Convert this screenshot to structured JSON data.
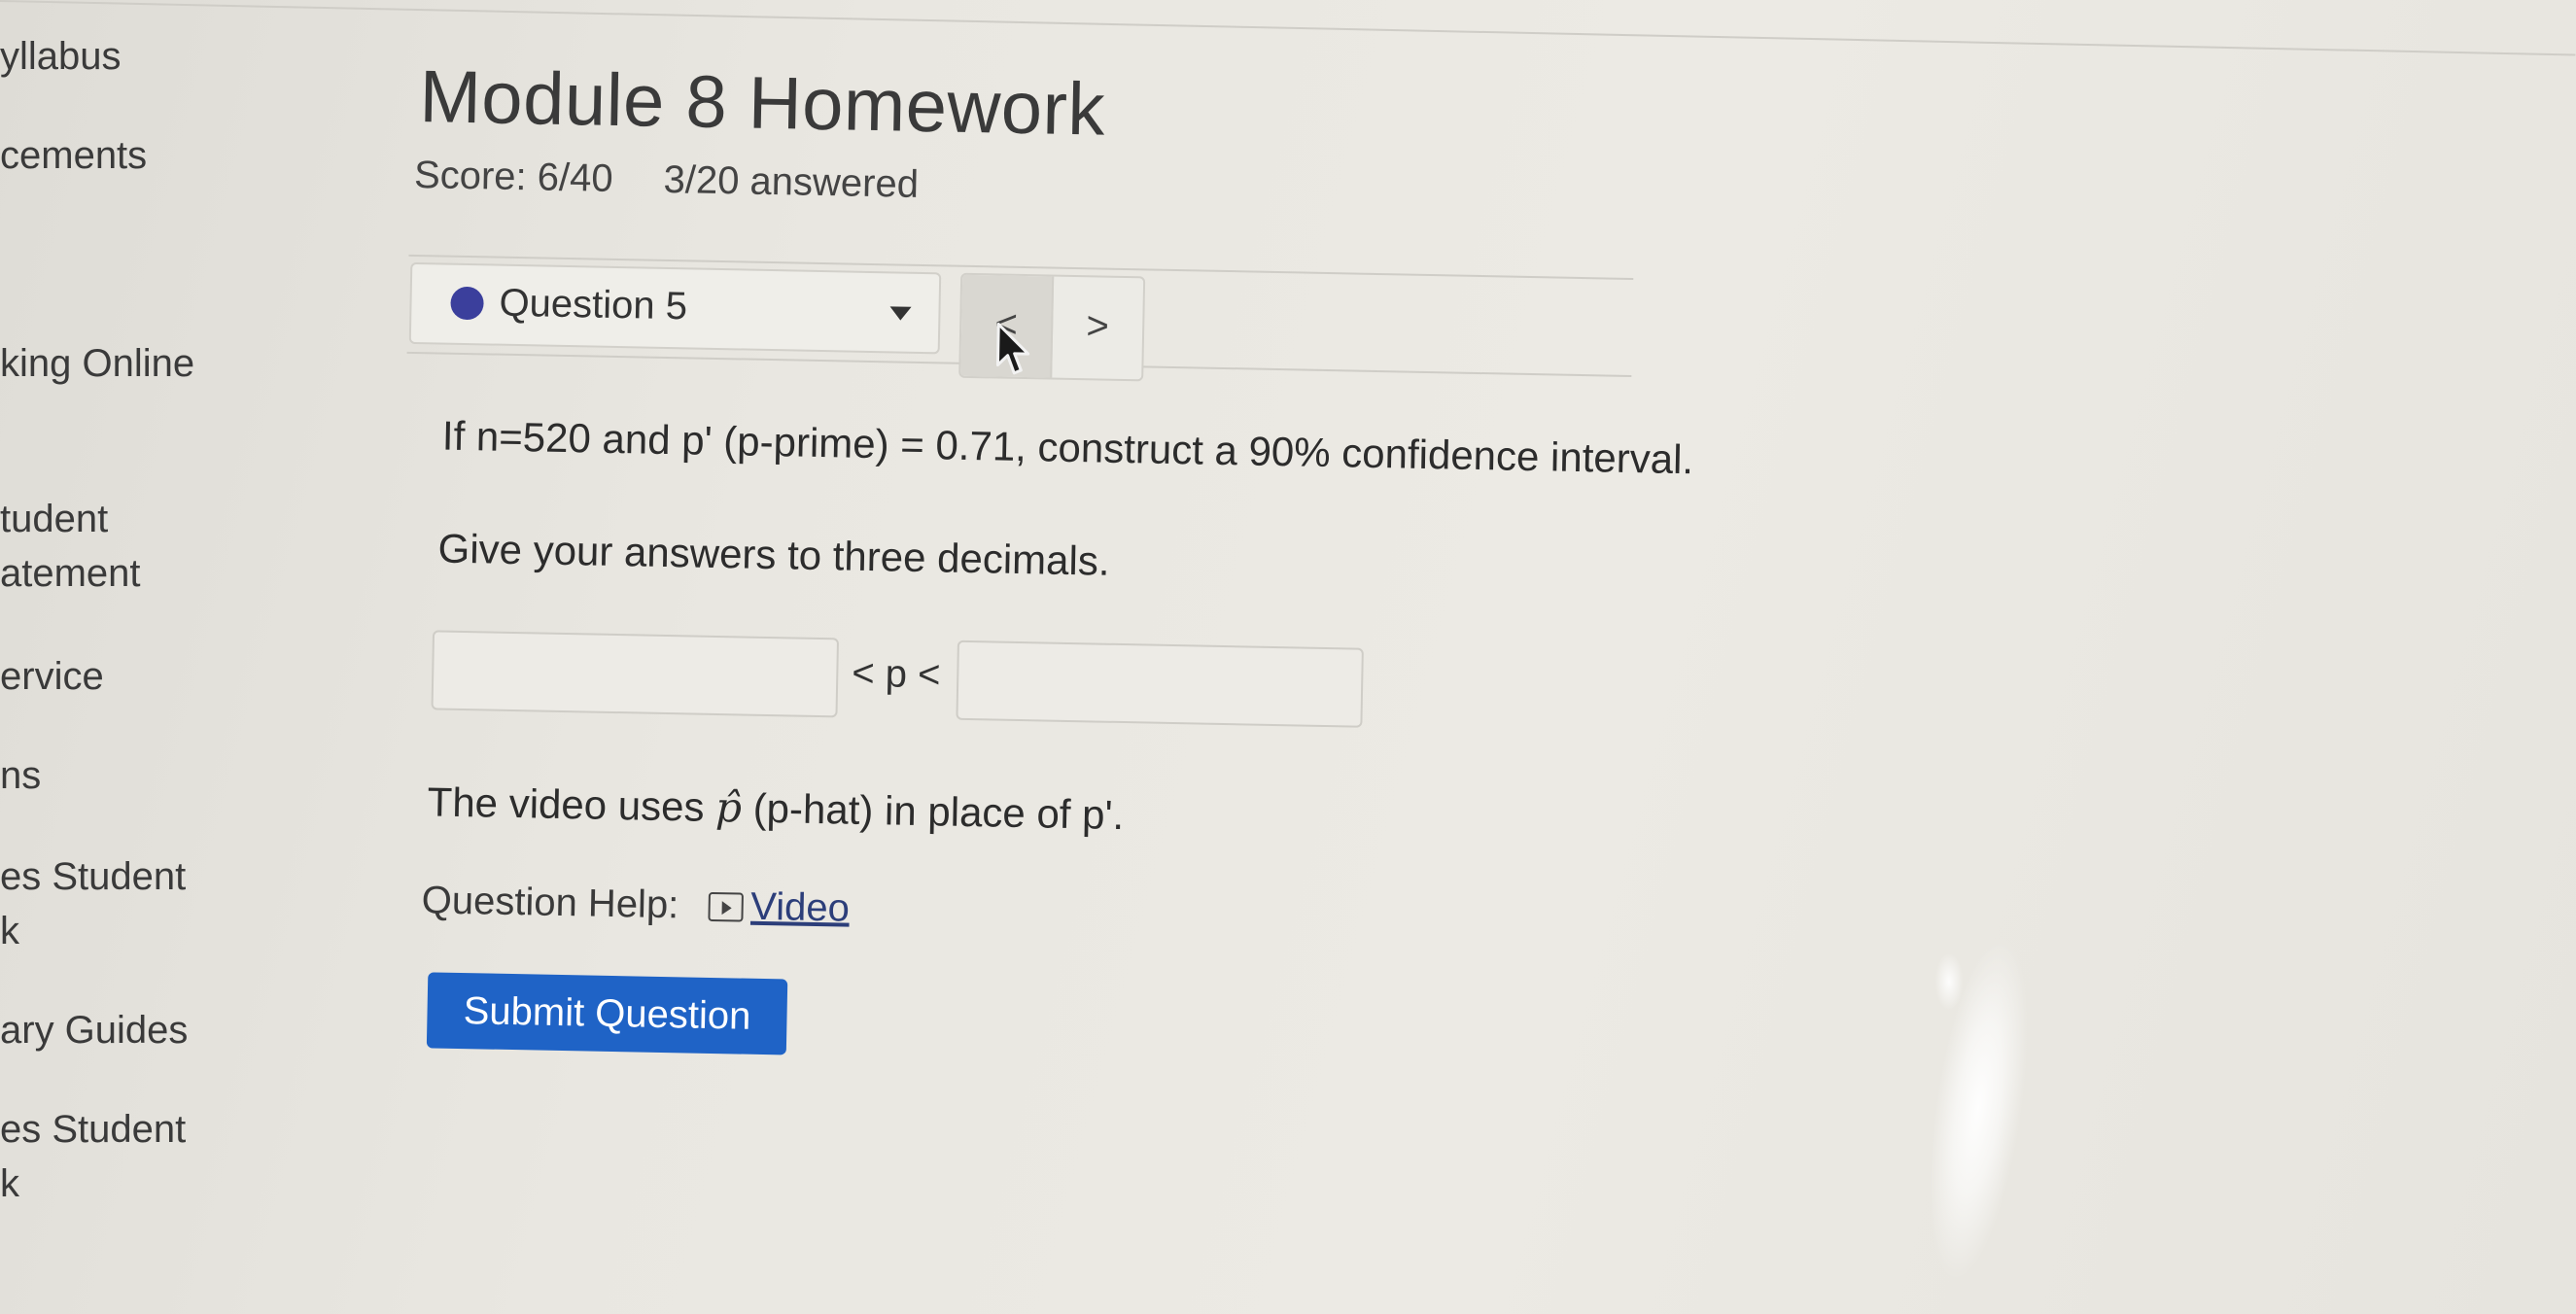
{
  "sidebar": {
    "items": [
      {
        "label": "yllabus"
      },
      {
        "label": "cements"
      },
      {
        "label": "king Online"
      },
      {
        "label": "tudent\natement"
      },
      {
        "label": "ervice"
      },
      {
        "label": "ns"
      },
      {
        "label": "es Student\nk"
      },
      {
        "label": "ary Guides"
      },
      {
        "label": "es Student\nk"
      }
    ]
  },
  "header": {
    "title": "Module 8 Homework",
    "score": "Score: 6/40",
    "answered": "3/20 answered"
  },
  "question_nav": {
    "selected": "Question 5",
    "status_color": "#3b3f9c",
    "prev_symbol": "<",
    "next_symbol": ">"
  },
  "question": {
    "prompt": "If n=520 and p' (p-prime) = 0.71, construct a 90% confidence interval.",
    "instruction": "Give your answers to three decimals.",
    "lower_value": "",
    "upper_value": "",
    "inequality": "< p <",
    "note_before": "The video uses ",
    "note_symbol": "p̂",
    "note_after": " (p-hat) in place of p'."
  },
  "help": {
    "label": "Question Help:",
    "video_label": "Video"
  },
  "actions": {
    "submit_label": "Submit Question",
    "submit_color": "#1f63c6"
  }
}
